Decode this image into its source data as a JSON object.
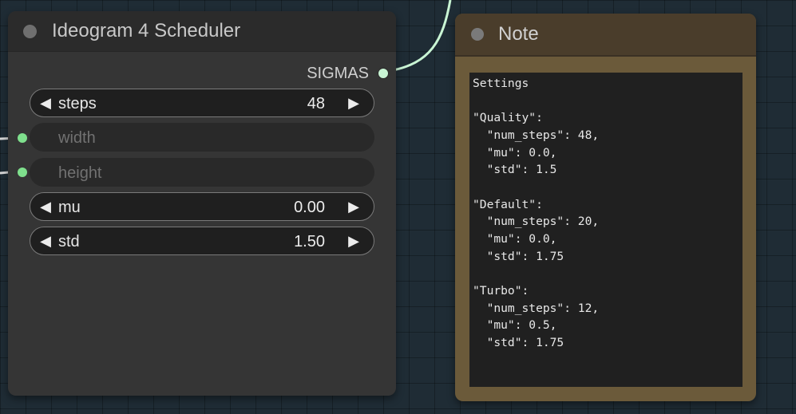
{
  "scheduler_node": {
    "title": "Ideogram 4 Scheduler",
    "output": {
      "label": "SIGMAS"
    },
    "widgets": [
      {
        "label": "steps",
        "value": "48"
      },
      {
        "label": "width"
      },
      {
        "label": "height"
      },
      {
        "label": "mu",
        "value": "0.00"
      },
      {
        "label": "std",
        "value": "1.50"
      }
    ],
    "arrows": {
      "decrement": "◀",
      "increment": "▶"
    }
  },
  "note_node": {
    "title": "Note",
    "text": "Settings\n\n\"Quality\":\n  \"num_steps\": 48,\n  \"mu\": 0.0,\n  \"std\": 1.5\n\n\"Default\":\n  \"num_steps\": 20,\n  \"mu\": 0.0,\n  \"std\": 1.75\n\n\"Turbo\":\n  \"num_steps\": 12,\n  \"mu\": 0.5,\n  \"std\": 1.75"
  },
  "colors": {
    "canvas_background": "#1f2c35",
    "node_body": "#353535",
    "node_header": "#2b2b2b",
    "note_body": "#6b5a3a",
    "note_header": "#4a3d2b",
    "sigmas_wire": "#c9f5d4",
    "input_slot": "#7fe08d"
  }
}
